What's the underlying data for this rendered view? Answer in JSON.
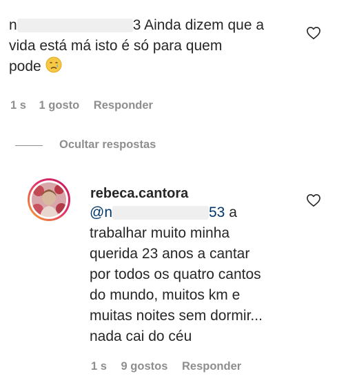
{
  "comment1": {
    "username_visible_start": "n",
    "username_visible_end": "3",
    "text_line1": "Ainda dizem que a",
    "text_line2": "vida está má isto é só para quem",
    "text_line3": "pode",
    "emoji": "crying-face-icon",
    "time": "1 s",
    "likes": "1 gosto",
    "reply_label": "Responder"
  },
  "hide_replies_label": "Ocultar respostas",
  "reply": {
    "username": "rebeca.cantora",
    "mention_start": "@n",
    "mention_end": "53",
    "lines": [
      "a",
      "trabalhar muito minha",
      "querida 23 anos a cantar",
      "por todos os quatro cantos",
      "do mundo, muitos km e",
      "muitas noites sem dormir...",
      "nada cai do céu"
    ],
    "time": "1 s",
    "likes": "9 gostos",
    "reply_label": "Responder"
  },
  "colors": {
    "text": "#262626",
    "meta": "#8e8e8e",
    "mention": "#00376b",
    "story_ring_start": "#f9a825",
    "story_ring_end": "#c2185b"
  }
}
